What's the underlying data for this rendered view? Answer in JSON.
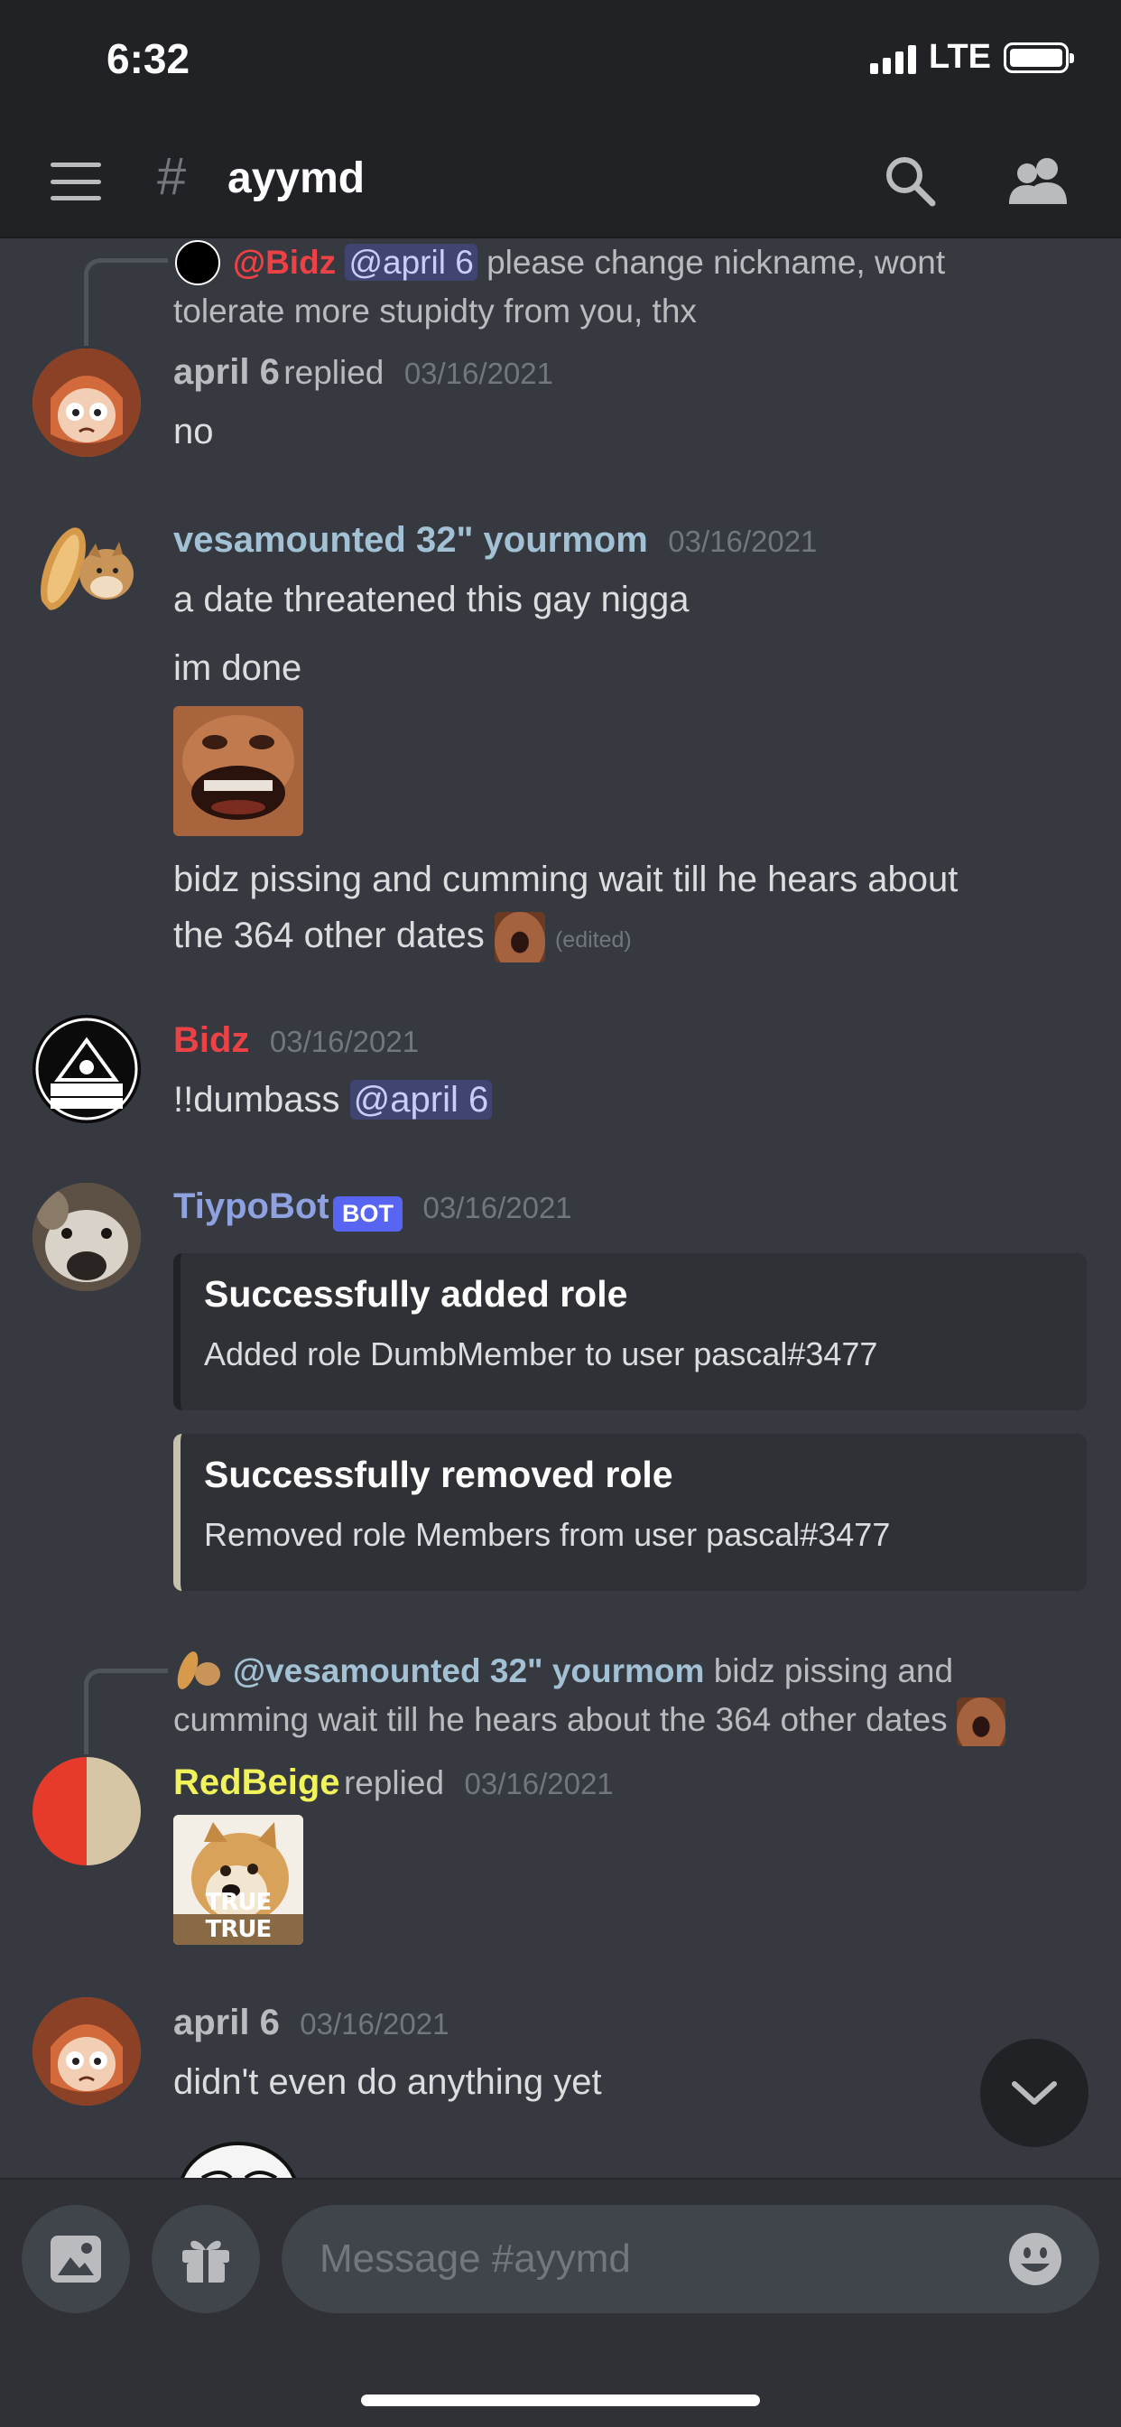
{
  "status_bar": {
    "time": "6:32",
    "network": "LTE"
  },
  "header": {
    "hash": "#",
    "channel_name": "ayymd"
  },
  "messages": [
    {
      "reply_to": {
        "author": "@Bidz",
        "mention": "@april 6",
        "text": "please change nickname, wont",
        "text2": "tolerate more stupidty from you, thx"
      },
      "author": "april 6",
      "replied_label": "replied",
      "timestamp": "03/16/2021",
      "lines": [
        "no"
      ]
    },
    {
      "author": "vesamounted 32\" yourmom",
      "timestamp": "03/16/2021",
      "lines": [
        "a date threatened this gay nigga",
        "im done"
      ],
      "line3": "bidz pissing and cumming wait till he hears about",
      "line4": "the 364 other dates",
      "edited": "(edited)"
    },
    {
      "author": "Bidz",
      "timestamp": "03/16/2021",
      "text": "!!dumbass",
      "mention": "@april 6"
    },
    {
      "author": "TiypoBot",
      "bot_tag": "BOT",
      "timestamp": "03/16/2021",
      "embeds": [
        {
          "title": "Successfully added role",
          "description": "Added role DumbMember to user pascal#3477",
          "accent": "#202225"
        },
        {
          "title": "Successfully removed role",
          "description": "Removed role Members from user pascal#3477",
          "accent": "#c7c2b0"
        }
      ]
    },
    {
      "reply_to": {
        "author": "@vesamounted 32\" yourmom",
        "text": "bidz pissing and",
        "text2": "cumming wait till he hears about the 364 other dates"
      },
      "author": "RedBeige",
      "replied_label": "replied",
      "timestamp": "03/16/2021",
      "image_caption": "TRUE TRUE"
    },
    {
      "author": "april 6",
      "timestamp": "03/16/2021",
      "lines": [
        "didn't even do anything yet"
      ]
    }
  ],
  "colors": {
    "bidz": "#ed4245",
    "redbeige": "#f1f35a",
    "april": "#b9bbbe",
    "vesa": "#a3c1d4",
    "bot": "#8ea1e1",
    "accent": "#5865f2"
  },
  "input": {
    "placeholder": "Message #ayymd"
  },
  "icons": [
    "hamburger-icon",
    "search-icon",
    "members-icon",
    "image-icon",
    "gift-icon",
    "emoji-icon",
    "chevron-down-icon"
  ]
}
